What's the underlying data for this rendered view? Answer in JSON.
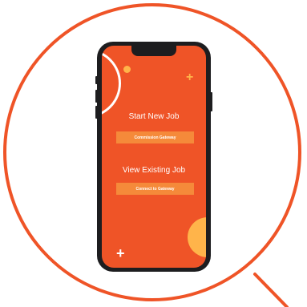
{
  "screen": {
    "start_heading": "Start New Job",
    "commission_button": "Commission Gateway",
    "view_heading": "View Existing Job",
    "connect_button": "Connect to Gateway"
  },
  "colors": {
    "accent": "#ef5427",
    "button": "#f58a3a",
    "highlight": "#ffb44a"
  }
}
